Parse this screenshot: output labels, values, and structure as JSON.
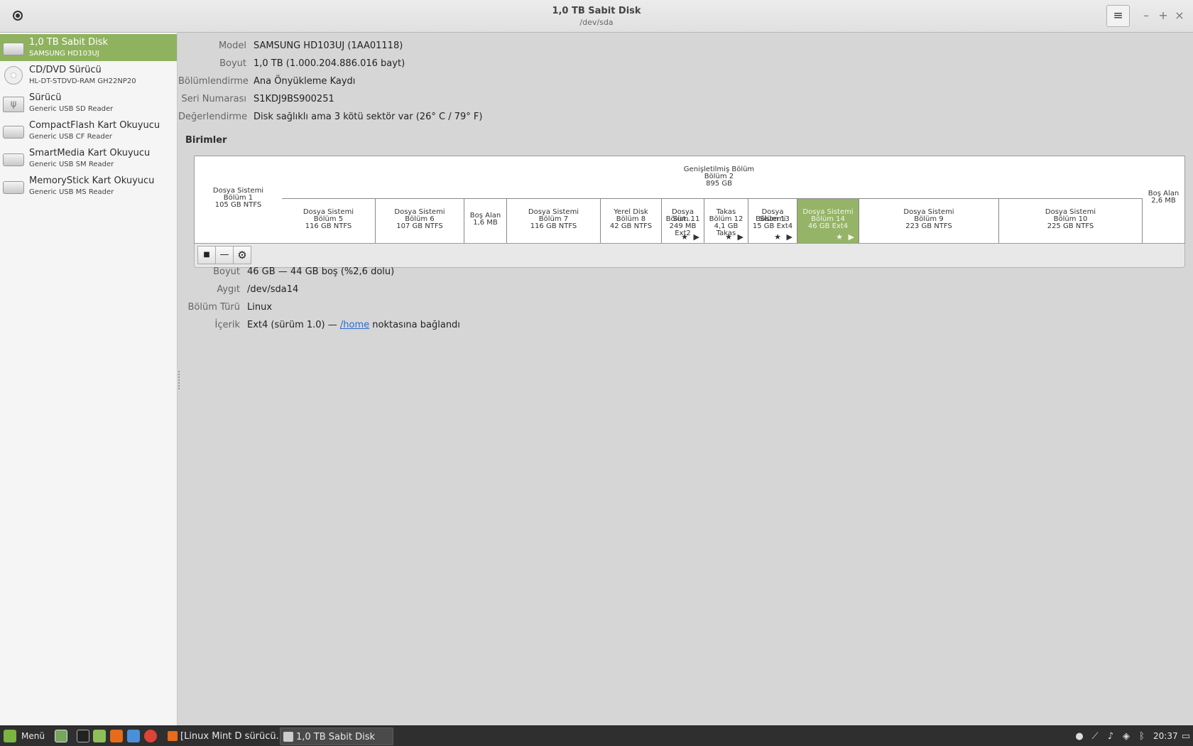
{
  "window": {
    "title": "1,0 TB Sabit Disk",
    "subtitle": "/dev/sda",
    "menu_icon": "≡",
    "minimize_icon": "–",
    "maximize_icon": "+",
    "close_icon": "×"
  },
  "sidebar": {
    "items": [
      {
        "title": "1,0 TB Sabit Disk",
        "subtitle": "SAMSUNG HD103UJ",
        "icon": "hard-disk-icon",
        "selected": true
      },
      {
        "title": "CD/DVD Sürücü",
        "subtitle": "HL-DT-STDVD-RAM GH22NP20",
        "icon": "optical-disc-icon",
        "selected": false
      },
      {
        "title": "Sürücü",
        "subtitle": "Generic USB SD Reader",
        "icon": "usb-drive-icon",
        "selected": false
      },
      {
        "title": "CompactFlash Kart Okuyucu",
        "subtitle": "Generic USB CF Reader",
        "icon": "card-reader-icon",
        "selected": false
      },
      {
        "title": "SmartMedia Kart Okuyucu",
        "subtitle": "Generic USB SM Reader",
        "icon": "card-reader-icon",
        "selected": false
      },
      {
        "title": "MemoryStick Kart Okuyucu",
        "subtitle": "Generic USB MS Reader",
        "icon": "card-reader-icon",
        "selected": false
      }
    ]
  },
  "disk": {
    "model_label": "Model",
    "model": "SAMSUNG HD103UJ (1AA01118)",
    "size_label": "Boyut",
    "size": "1,0 TB (1.000.204.886.016 bayt)",
    "partitioning_label": "Bölümlendirme",
    "partitioning": "Ana Önyükleme Kaydı",
    "serial_label": "Seri Numarası",
    "serial": "S1KDJ9BS900251",
    "assessment_label": "Değerlendirme",
    "assessment": "Disk sağlıklı ama 3 kötü sektör var (26° C / 79° F)"
  },
  "volumes": {
    "section_title": "Birimler",
    "first": {
      "l1": "Dosya Sistemi",
      "l2": "Bölüm 1",
      "l3": "105 GB NTFS"
    },
    "extended": {
      "l1": "Genişletilmiş Bölüm",
      "l2": "Bölüm 2",
      "l3": "895 GB"
    },
    "last": {
      "l1": "Boş Alan",
      "l2": "2,6 MB"
    },
    "logical": [
      {
        "l1": "Dosya Sistemi",
        "l2": "Bölüm 5",
        "l3": "116 GB NTFS",
        "marks": ""
      },
      {
        "l1": "Dosya Sistemi",
        "l2": "Bölüm 6",
        "l3": "107 GB NTFS",
        "marks": ""
      },
      {
        "l1": "Boş Alan",
        "l2": "1,6 MB",
        "l3": "",
        "marks": ""
      },
      {
        "l1": "Dosya Sistemi",
        "l2": "Bölüm 7",
        "l3": "116 GB NTFS",
        "marks": ""
      },
      {
        "l1": "Yerel Disk",
        "l2": "Bölüm 8",
        "l3": "42 GB NTFS",
        "marks": ""
      },
      {
        "l1": "Dosya Sist...",
        "l2": "Bölüm 11",
        "l3": "249 MB Ext2",
        "marks": "★ ▶"
      },
      {
        "l1": "Takas",
        "l2": "Bölüm 12",
        "l3": "4,1 GB Takas",
        "marks": "★ ▶"
      },
      {
        "l1": "Dosya Sistemi",
        "l2": "Bölüm 13",
        "l3": "15 GB Ext4",
        "marks": "★ ▶"
      },
      {
        "l1": "Dosya Sistemi",
        "l2": "Bölüm 14",
        "l3": "46 GB Ext4",
        "marks": "★ ▶",
        "selected": true
      },
      {
        "l1": "Dosya Sistemi",
        "l2": "Bölüm 9",
        "l3": "223 GB NTFS",
        "marks": ""
      },
      {
        "l1": "Dosya Sistemi",
        "l2": "Bölüm 10",
        "l3": "225 GB NTFS",
        "marks": ""
      }
    ],
    "toolbar": {
      "stop_icon": "■",
      "remove_icon": "—",
      "settings_icon": "⚙"
    }
  },
  "partition": {
    "size_label": "Boyut",
    "size": "46 GB — 44 GB boş (%2,6 dolu)",
    "device_label": "Aygıt",
    "device": "/dev/sda14",
    "type_label": "Bölüm Türü",
    "type": "Linux",
    "contents_label": "İçerik",
    "contents_prefix": "Ext4 (sürüm 1.0) — ",
    "contents_link": "/home",
    "contents_suffix": " noktasına bağlandı"
  },
  "taskbar": {
    "menu_label": "Menü",
    "windows": [
      {
        "label": "[Linux Mint D sürücü...",
        "active": false
      },
      {
        "label": "1,0 TB Sabit Disk",
        "active": true
      }
    ],
    "clock": "20:37"
  }
}
